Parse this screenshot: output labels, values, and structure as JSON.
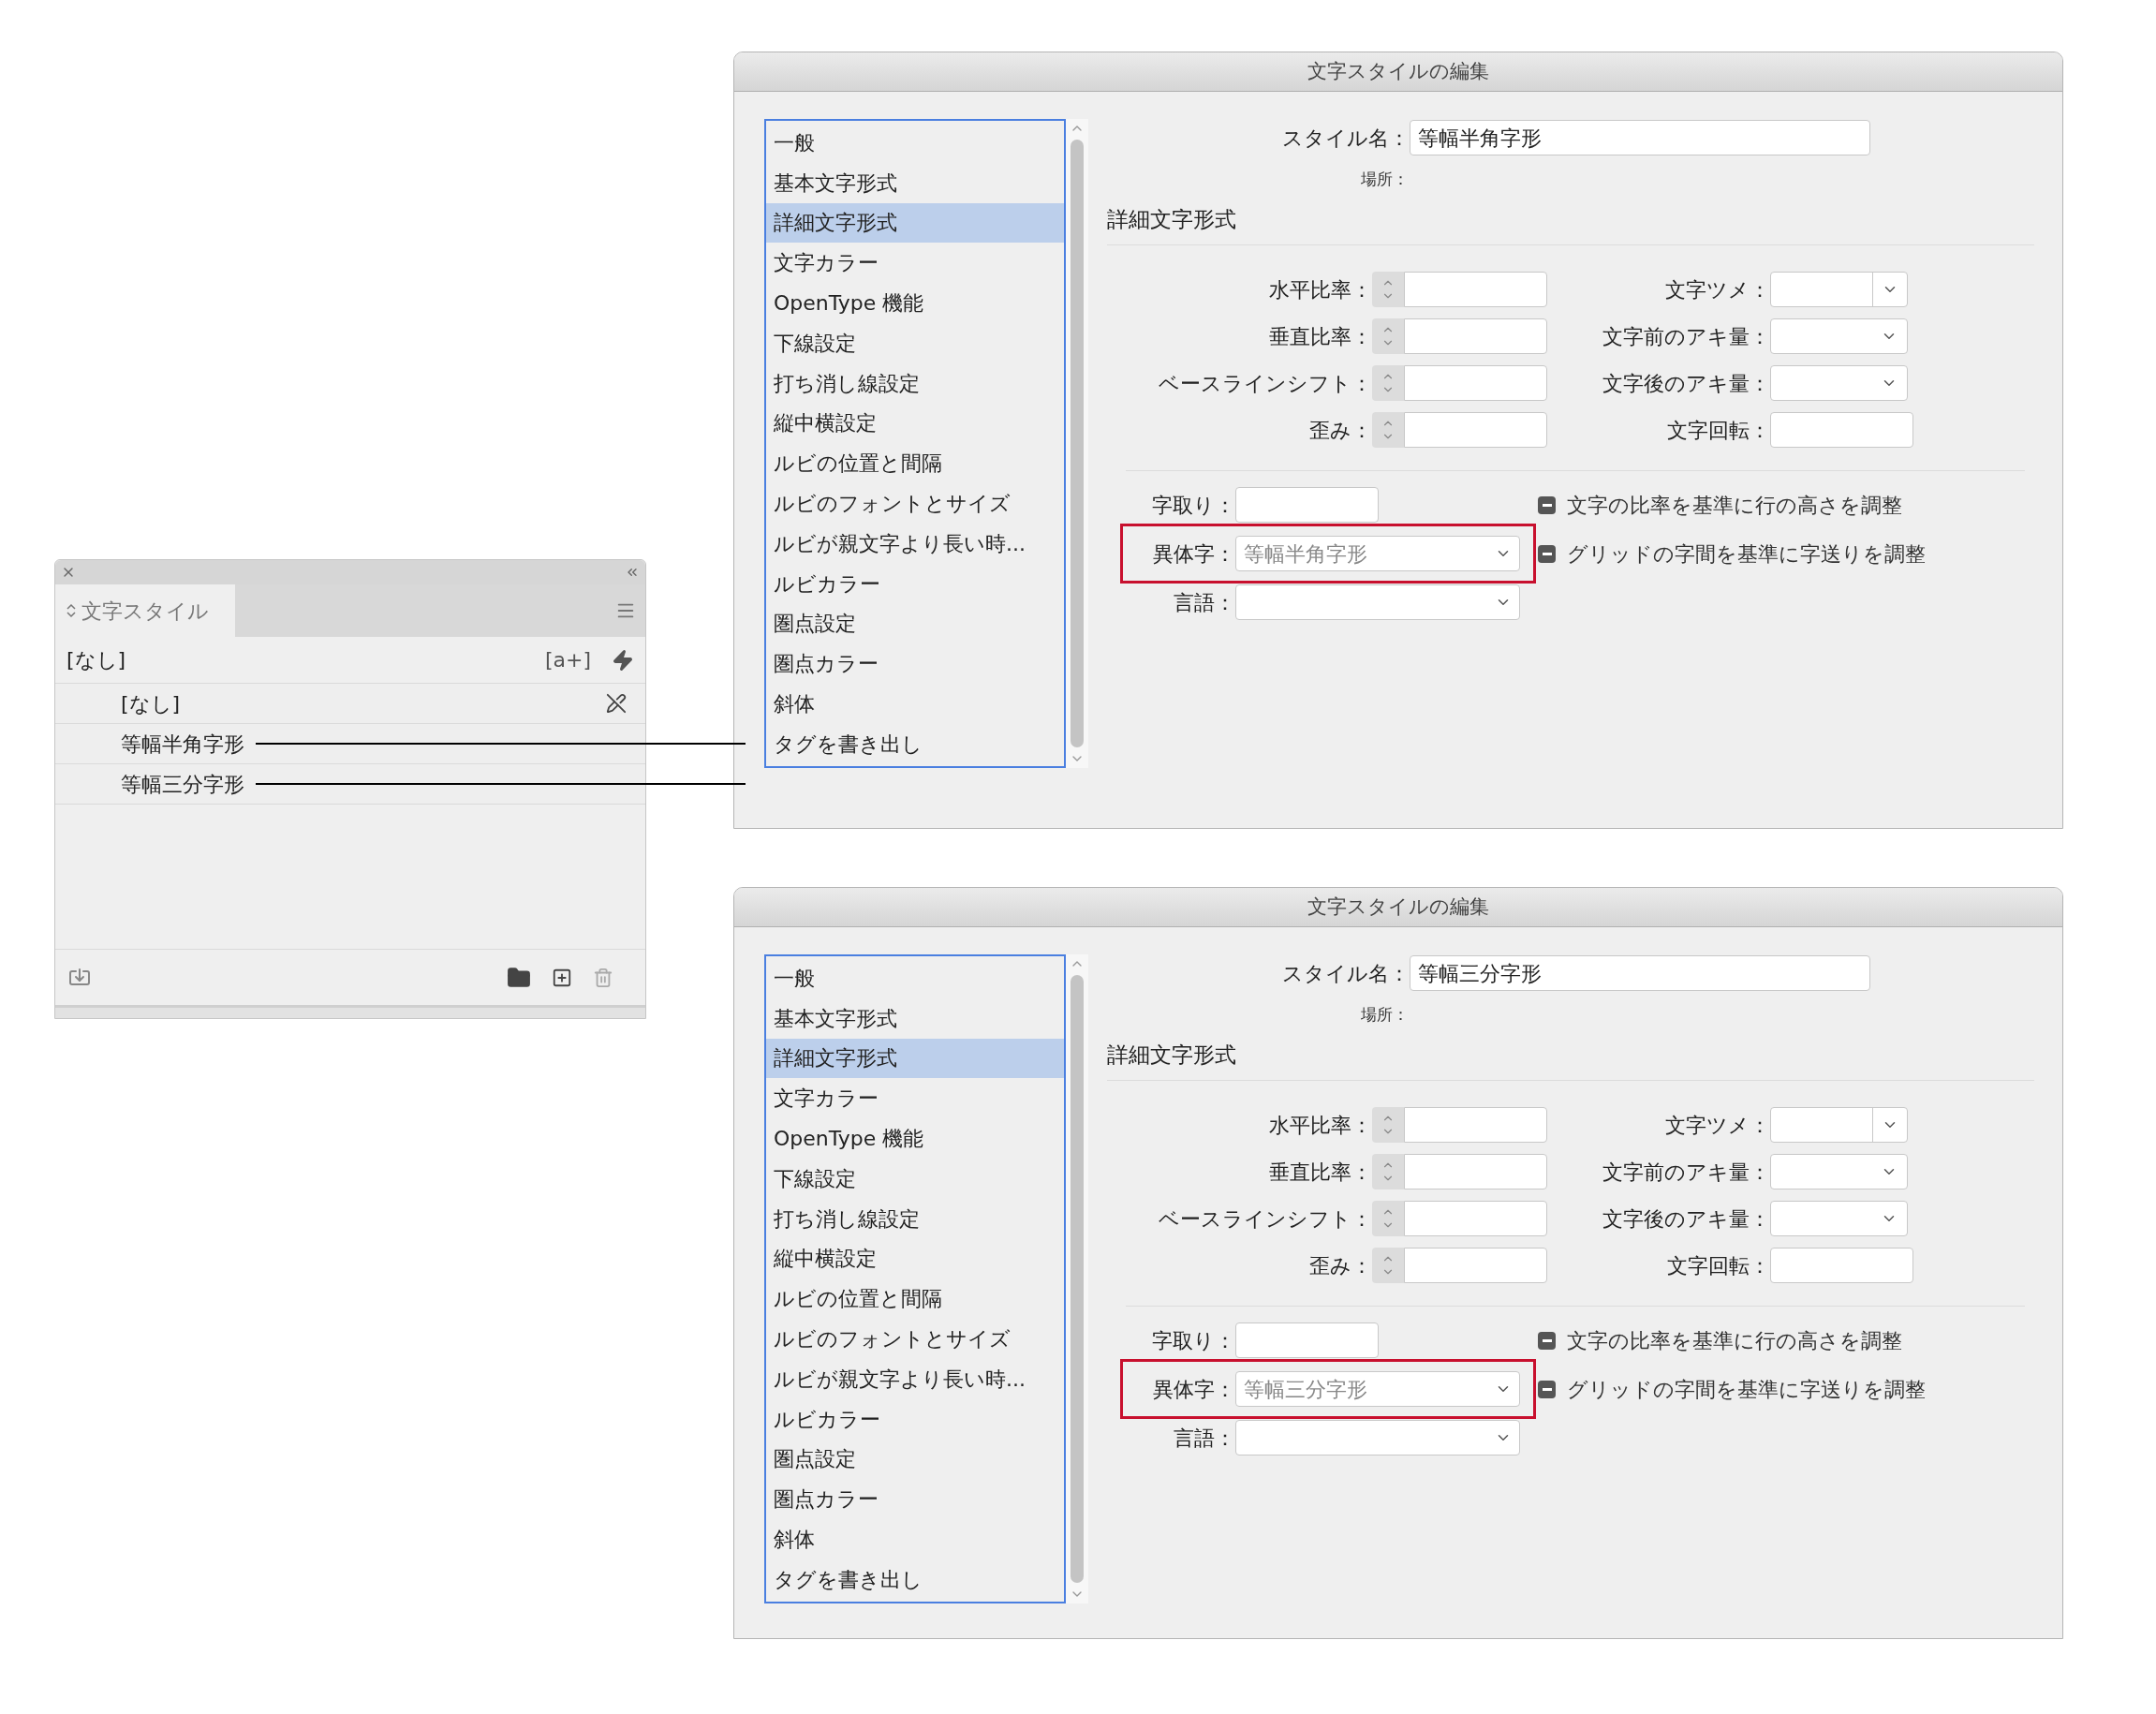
{
  "panel": {
    "tab": "文字スタイル",
    "current_style": "[なし]",
    "override_label": "[a+]",
    "styles": [
      {
        "name": "[なし]",
        "kind": "default",
        "leader": false
      },
      {
        "name": "等幅半角字形",
        "kind": "style",
        "leader": true
      },
      {
        "name": "等幅三分字形",
        "kind": "style",
        "leader": true
      }
    ]
  },
  "dialogs": [
    {
      "title": "文字スタイルの編集",
      "style_name_label": "スタイル名：",
      "style_name": "等幅半角字形",
      "location_label": "場所：",
      "section": "詳細文字形式",
      "categories": [
        {
          "label": "一般",
          "selected": false
        },
        {
          "label": "基本文字形式",
          "selected": false
        },
        {
          "label": "詳細文字形式",
          "selected": true
        },
        {
          "label": "文字カラー",
          "selected": false
        },
        {
          "label": "OpenType 機能",
          "selected": false
        },
        {
          "label": "下線設定",
          "selected": false
        },
        {
          "label": "打ち消し線設定",
          "selected": false
        },
        {
          "label": "縦中横設定",
          "selected": false
        },
        {
          "label": "ルビの位置と間隔",
          "selected": false
        },
        {
          "label": "ルビのフォントとサイズ",
          "selected": false
        },
        {
          "label": "ルビが親文字より長い時...",
          "selected": false
        },
        {
          "label": "ルビカラー",
          "selected": false
        },
        {
          "label": "圏点設定",
          "selected": false
        },
        {
          "label": "圏点カラー",
          "selected": false
        },
        {
          "label": "斜体",
          "selected": false
        },
        {
          "label": "タグを書き出し",
          "selected": false
        }
      ],
      "grid": [
        {
          "left": "水平比率：",
          "right": {
            "label": "文字ツメ：",
            "kind": "combo"
          }
        },
        {
          "left": "垂直比率：",
          "right": {
            "label": "文字前のアキ量：",
            "kind": "dropdown"
          }
        },
        {
          "left": "ベースラインシフト：",
          "right": {
            "label": "文字後のアキ量：",
            "kind": "dropdown"
          }
        },
        {
          "left": "歪み：",
          "right": {
            "label": "文字回転：",
            "kind": "text"
          }
        }
      ],
      "lower": [
        {
          "label": "字取り：",
          "kind": "text",
          "highlighted": false,
          "checkbox": {
            "label": "文字の比率を基準に行の高さを調整",
            "indeterminate": true
          }
        },
        {
          "label": "異体字：",
          "kind": "dropdown",
          "value": "等幅半角字形",
          "highlighted": true,
          "checkbox": {
            "label": "グリッドの字間を基準に字送りを調整",
            "indeterminate": true
          }
        },
        {
          "label": "言語：",
          "kind": "dropdown",
          "highlighted": false
        }
      ]
    },
    {
      "title": "文字スタイルの編集",
      "style_name_label": "スタイル名：",
      "style_name": "等幅三分字形",
      "location_label": "場所：",
      "section": "詳細文字形式",
      "categories": [
        {
          "label": "一般",
          "selected": false
        },
        {
          "label": "基本文字形式",
          "selected": false
        },
        {
          "label": "詳細文字形式",
          "selected": true
        },
        {
          "label": "文字カラー",
          "selected": false
        },
        {
          "label": "OpenType 機能",
          "selected": false
        },
        {
          "label": "下線設定",
          "selected": false
        },
        {
          "label": "打ち消し線設定",
          "selected": false
        },
        {
          "label": "縦中横設定",
          "selected": false
        },
        {
          "label": "ルビの位置と間隔",
          "selected": false
        },
        {
          "label": "ルビのフォントとサイズ",
          "selected": false
        },
        {
          "label": "ルビが親文字より長い時...",
          "selected": false
        },
        {
          "label": "ルビカラー",
          "selected": false
        },
        {
          "label": "圏点設定",
          "selected": false
        },
        {
          "label": "圏点カラー",
          "selected": false
        },
        {
          "label": "斜体",
          "selected": false
        },
        {
          "label": "タグを書き出し",
          "selected": false
        }
      ],
      "grid": [
        {
          "left": "水平比率：",
          "right": {
            "label": "文字ツメ：",
            "kind": "combo"
          }
        },
        {
          "left": "垂直比率：",
          "right": {
            "label": "文字前のアキ量：",
            "kind": "dropdown"
          }
        },
        {
          "left": "ベースラインシフト：",
          "right": {
            "label": "文字後のアキ量：",
            "kind": "dropdown"
          }
        },
        {
          "left": "歪み：",
          "right": {
            "label": "文字回転：",
            "kind": "text"
          }
        }
      ],
      "lower": [
        {
          "label": "字取り：",
          "kind": "text",
          "highlighted": false,
          "checkbox": {
            "label": "文字の比率を基準に行の高さを調整",
            "indeterminate": true
          }
        },
        {
          "label": "異体字：",
          "kind": "dropdown",
          "value": "等幅三分字形",
          "highlighted": true,
          "checkbox": {
            "label": "グリッドの字間を基準に字送りを調整",
            "indeterminate": true
          }
        },
        {
          "label": "言語：",
          "kind": "dropdown",
          "highlighted": false
        }
      ]
    }
  ]
}
